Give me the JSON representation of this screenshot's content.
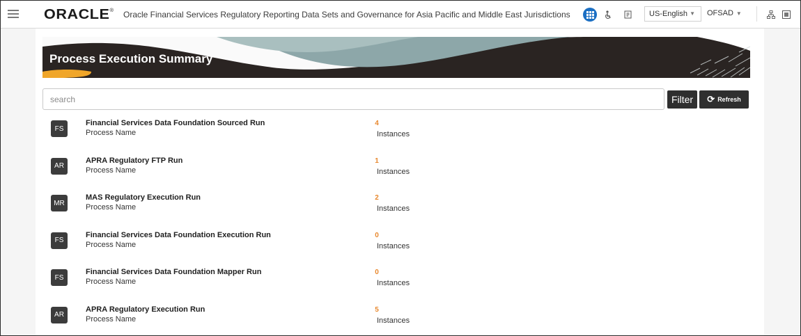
{
  "header": {
    "logo_text": "ORACLE",
    "app_title": "Oracle Financial Services Regulatory Reporting Data Sets and Governance for Asia Pacific and Middle East Jurisdictions",
    "language": "US-English",
    "user": "OFSAD",
    "accent_color": "#1b6fc3"
  },
  "page": {
    "title": "Process Execution Summary",
    "banner_color": "#2a2422"
  },
  "search": {
    "placeholder": "search"
  },
  "toolbar": {
    "filter_label": "Filter",
    "refresh_label": "Refresh"
  },
  "processes": [
    {
      "badge": "FS",
      "name": "Financial Services Data Foundation Sourced Run",
      "subtitle": "Process Name",
      "count": "4",
      "count_label": "Instances"
    },
    {
      "badge": "AR",
      "name": "APRA Regulatory FTP Run",
      "subtitle": "Process Name",
      "count": "1",
      "count_label": "Instances"
    },
    {
      "badge": "MR",
      "name": "MAS Regulatory Execution Run",
      "subtitle": "Process Name",
      "count": "2",
      "count_label": "Instances"
    },
    {
      "badge": "FS",
      "name": "Financial Services Data Foundation Execution Run",
      "subtitle": "Process Name",
      "count": "0",
      "count_label": "Instances"
    },
    {
      "badge": "FS",
      "name": "Financial Services Data Foundation Mapper Run",
      "subtitle": "Process Name",
      "count": "0",
      "count_label": "Instances"
    },
    {
      "badge": "AR",
      "name": "APRA Regulatory Execution Run",
      "subtitle": "Process Name",
      "count": "5",
      "count_label": "Instances"
    }
  ],
  "colors": {
    "count": "#e8882e",
    "badge": "#3c3c3c"
  }
}
